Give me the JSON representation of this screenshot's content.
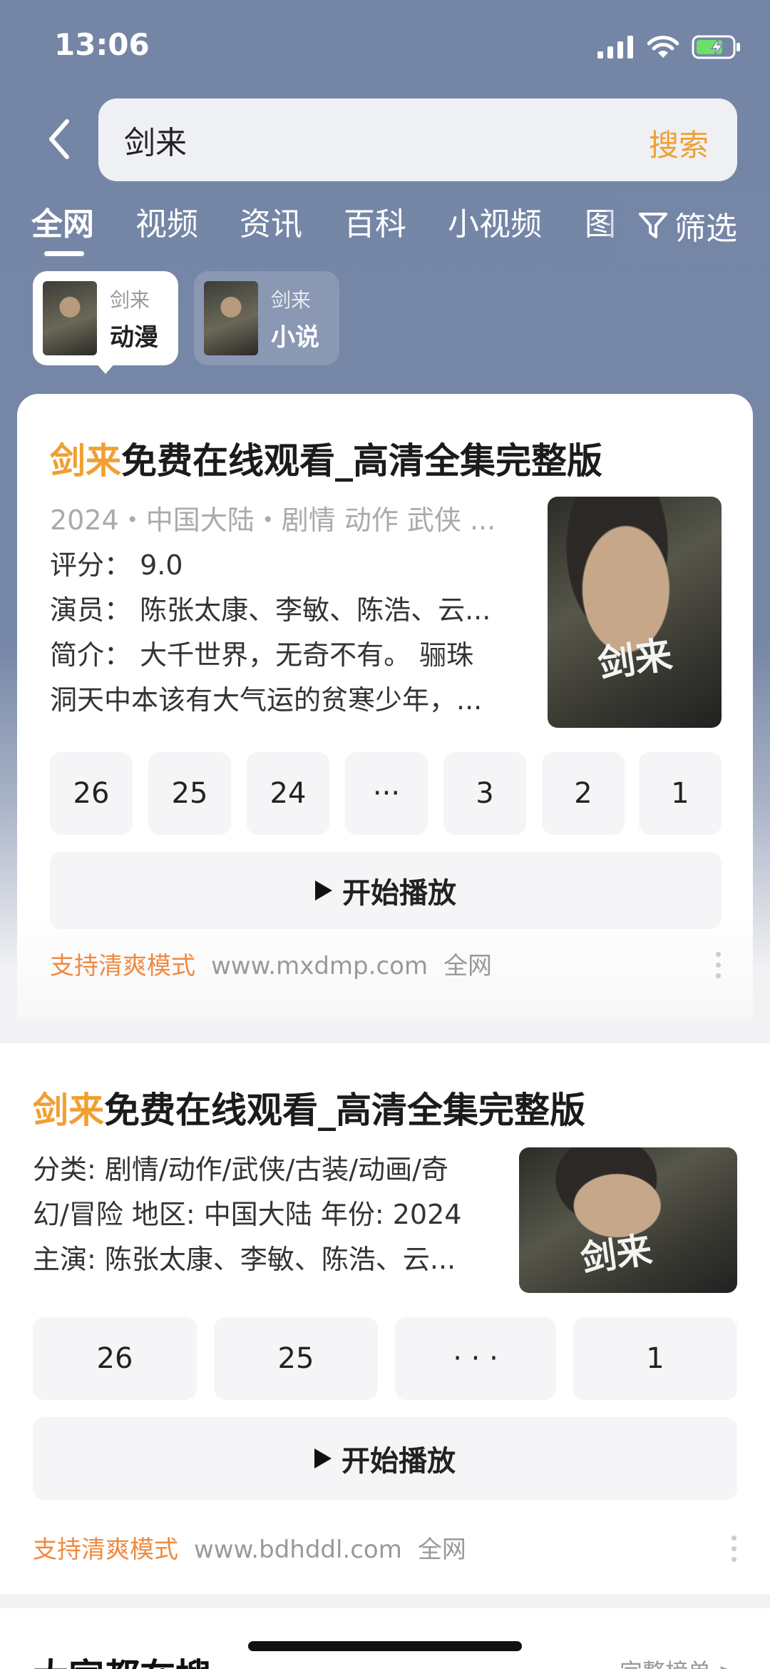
{
  "status_bar": {
    "time": "13:06"
  },
  "search": {
    "query": "剑来",
    "button": "搜索"
  },
  "tabs": [
    {
      "label": "全网",
      "active": true
    },
    {
      "label": "视频"
    },
    {
      "label": "资讯"
    },
    {
      "label": "百科"
    },
    {
      "label": "小视频"
    },
    {
      "label": "图"
    }
  ],
  "filter": {
    "label": "筛选"
  },
  "pills": [
    {
      "sub": "剑来",
      "main": "动漫",
      "active": true
    },
    {
      "sub": "剑来",
      "main": "小说"
    }
  ],
  "result1": {
    "title_highlight": "剑来",
    "title_rest": "免费在线观看_高清全集完整版",
    "meta_line": "2024・中国大陆・剧情 动作 武侠 ...",
    "rating": "评分：  9.0",
    "cast": "演员：  陈张太康、李敏、陈浩、云...",
    "intro1": "简介：  大千世界，无奇不有。 骊珠",
    "intro2": "洞天中本该有大气运的贫寒少年，...",
    "poster_sig": "剑来",
    "episodes": [
      "26",
      "25",
      "24",
      "···",
      "3",
      "2",
      "1"
    ],
    "play": "开始播放",
    "source_tag": "支持清爽模式",
    "source_url": "www.mxdmp.com",
    "source_scope": "全网"
  },
  "result2": {
    "title_highlight": "剑来",
    "title_rest": "免费在线观看_高清全集完整版",
    "line1": "分类: 剧情/动作/武侠/古装/动画/奇",
    "line2": "幻/冒险 地区: 中国大陆 年份: 2024",
    "line3": "主演: 陈张太康、李敏、陈浩、云...",
    "poster_sig": "剑来",
    "episodes": [
      "26",
      "25",
      "· · ·",
      "1"
    ],
    "play": "开始播放",
    "source_tag": "支持清爽模式",
    "source_url": "www.bdhddl.com",
    "source_scope": "全网"
  },
  "section3": {
    "heading": "大家都在搜",
    "more": "完整榜单 >"
  },
  "colors": {
    "accent": "#f0a030",
    "header_bg": "#7686a7"
  }
}
